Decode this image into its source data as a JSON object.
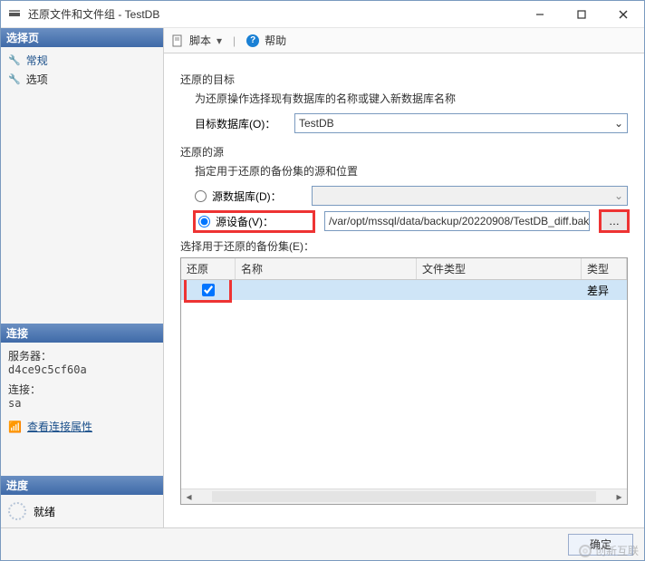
{
  "window": {
    "title": "还原文件和文件组 - TestDB"
  },
  "sidebar": {
    "select_page_header": "选择页",
    "items": [
      {
        "label": "常规"
      },
      {
        "label": "选项"
      }
    ],
    "connection_header": "连接",
    "server_label": "服务器：",
    "server_value": "d4ce9c5cf60a",
    "conn_label": "连接：",
    "conn_value": "sa",
    "view_conn_props": "查看连接属性",
    "progress_header": "进度",
    "progress_status": "就绪"
  },
  "toolbar": {
    "script": "脚本",
    "help": "帮助"
  },
  "restore_target": {
    "title": "还原的目标",
    "desc": "为还原操作选择现有数据库的名称或键入新数据库名称",
    "db_label": "目标数据库(O)：",
    "db_value": "TestDB"
  },
  "restore_source": {
    "title": "还原的源",
    "desc": "指定用于还原的备份集的源和位置",
    "radio_db_label": "源数据库(D)：",
    "radio_device_label": "源设备(V)：",
    "device_path": "/var/opt/mssql/data/backup/20220908/TestDB_diff.bak",
    "browse": "…",
    "backupsets_label": "选择用于还原的备份集(E)：",
    "grid": {
      "col_restore": "还原",
      "col_name": "名称",
      "col_filetype": "文件类型",
      "col_type": "类型",
      "rows": [
        {
          "checked": true,
          "name": "",
          "filetype": "",
          "type": "差异"
        }
      ]
    }
  },
  "buttons": {
    "ok": "确定"
  },
  "watermark": "创新互联"
}
